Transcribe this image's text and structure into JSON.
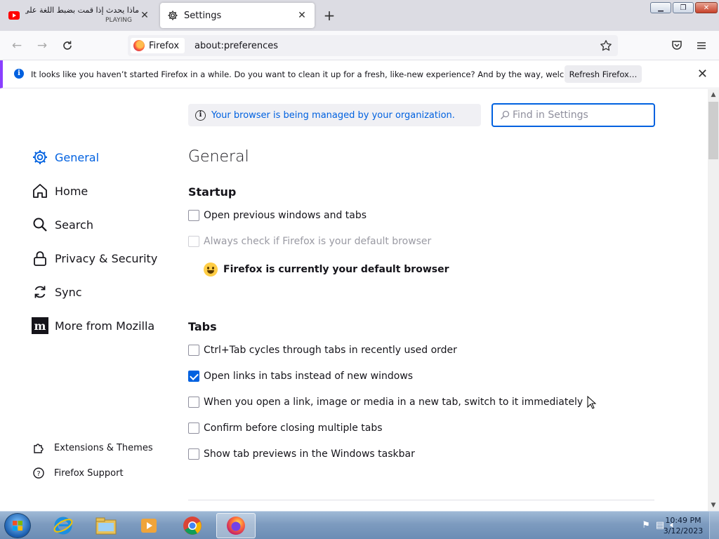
{
  "tabs": [
    {
      "title": "ماذا يحدث إذا قمت بضبط اللغة على",
      "subtitle": "PLAYING",
      "icon": "youtube-icon"
    },
    {
      "title": "Settings",
      "icon": "gear-icon"
    }
  ],
  "navbar": {
    "identity_label": "Firefox",
    "url": "about:preferences"
  },
  "notification": {
    "message": "It looks like you haven’t started Firefox in a while. Do you want to clean it up for a fresh, like-new experience? And by the way, welcome back!",
    "button": "Refresh Firefox…"
  },
  "settings": {
    "managed_message": "Your browser is being managed by your organization.",
    "search_placeholder": "Find in Settings",
    "sidebar": [
      {
        "label": "General",
        "icon": "gear-icon",
        "selected": true
      },
      {
        "label": "Home",
        "icon": "home-icon"
      },
      {
        "label": "Search",
        "icon": "search-icon"
      },
      {
        "label": "Privacy & Security",
        "icon": "lock-icon"
      },
      {
        "label": "Sync",
        "icon": "sync-icon"
      },
      {
        "label": "More from Mozilla",
        "icon": "mozilla-icon"
      }
    ],
    "sidebar_footer": [
      {
        "label": "Extensions & Themes",
        "icon": "puzzle-icon"
      },
      {
        "label": "Firefox Support",
        "icon": "help-icon"
      }
    ],
    "page_title": "General",
    "startup": {
      "heading": "Startup",
      "open_previous": {
        "label": "Open previous windows and tabs",
        "checked": false
      },
      "always_check": {
        "label": "Always check if Firefox is your default browser",
        "checked": false,
        "disabled": true
      },
      "default_status": "Firefox is currently your default browser"
    },
    "tabs_section": {
      "heading": "Tabs",
      "options": [
        {
          "label": "Ctrl+Tab cycles through tabs in recently used order",
          "checked": false
        },
        {
          "label": "Open links in tabs instead of new windows",
          "checked": true
        },
        {
          "label": "When you open a link, image or media in a new tab, switch to it immediately",
          "checked": false
        },
        {
          "label": "Confirm before closing multiple tabs",
          "checked": false
        },
        {
          "label": "Show tab previews in the Windows taskbar",
          "checked": false
        }
      ]
    }
  },
  "taskbar": {
    "clock_time": "10:49 PM",
    "clock_date": "3/12/2023",
    "apps": [
      "internet-explorer-icon",
      "file-explorer-icon",
      "media-player-icon",
      "chrome-icon",
      "firefox-icon"
    ]
  },
  "colors": {
    "accent": "#0061e0",
    "tabstrip": "#dcdce3"
  }
}
